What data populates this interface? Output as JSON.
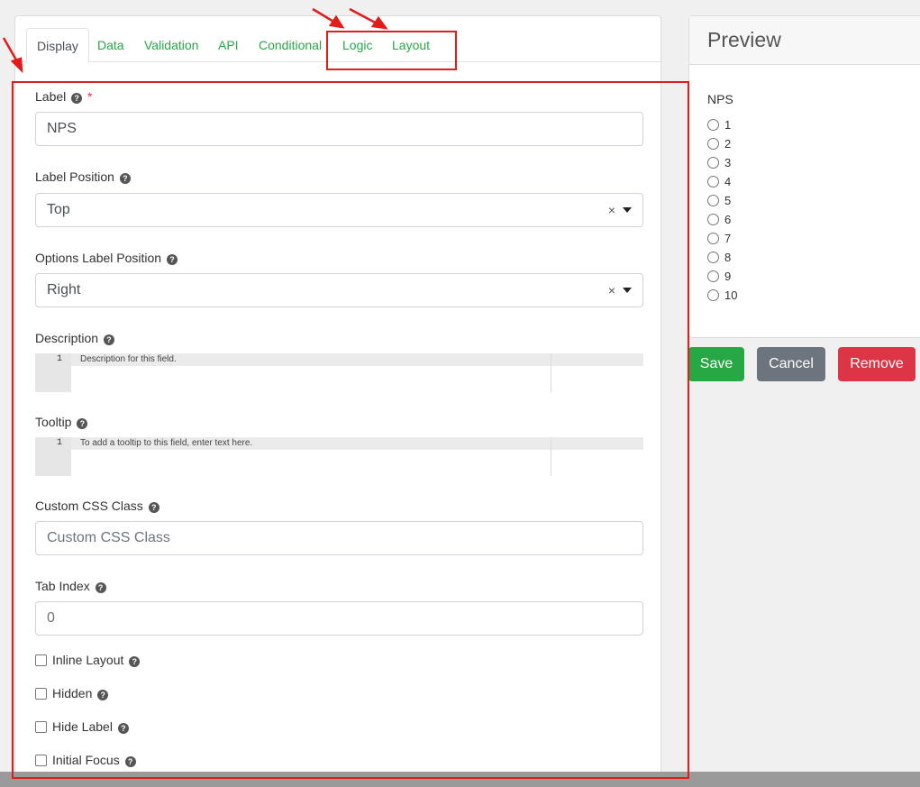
{
  "tabs": [
    {
      "label": "Display",
      "active": true
    },
    {
      "label": "Data"
    },
    {
      "label": "Validation"
    },
    {
      "label": "API"
    },
    {
      "label": "Conditional"
    },
    {
      "label": "Logic"
    },
    {
      "label": "Layout"
    }
  ],
  "form": {
    "label": {
      "label": "Label",
      "required_mark": "*",
      "value": "NPS"
    },
    "label_position": {
      "label": "Label Position",
      "value": "Top",
      "clear": "×"
    },
    "options_label_position": {
      "label": "Options Label Position",
      "value": "Right",
      "clear": "×"
    },
    "description": {
      "label": "Description",
      "line_number": "1",
      "placeholder": "Description for this field."
    },
    "tooltip": {
      "label": "Tooltip",
      "line_number": "1",
      "placeholder": "To add a tooltip to this field, enter text here."
    },
    "custom_css": {
      "label": "Custom CSS Class",
      "placeholder": "Custom CSS Class"
    },
    "tab_index": {
      "label": "Tab Index",
      "value": "0"
    },
    "checkboxes": {
      "inline_layout": "Inline Layout",
      "hidden": "Hidden",
      "hide_label": "Hide Label",
      "initial_focus": "Initial Focus"
    }
  },
  "help_glyph": "?",
  "preview": {
    "title": "Preview",
    "field_label": "NPS",
    "options": [
      "1",
      "2",
      "3",
      "4",
      "5",
      "6",
      "7",
      "8",
      "9",
      "10"
    ]
  },
  "buttons": {
    "save": "Save",
    "cancel": "Cancel",
    "remove": "Remove"
  },
  "colors": {
    "accent": "#28a745",
    "danger": "#dc3545",
    "secondary": "#6c757d",
    "annotation": "#e31b1b"
  }
}
